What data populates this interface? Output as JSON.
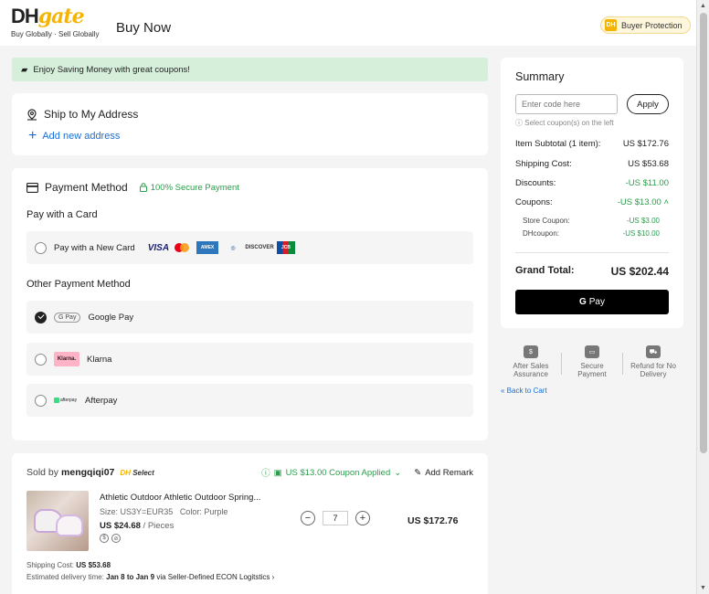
{
  "header": {
    "logo_dh": "DH",
    "logo_gate": "gate",
    "logo_tagline": "Buy Globally · Sell Globally",
    "page_title": "Buy Now",
    "buyer_protection": "Buyer Protection",
    "bp_badge": "DH"
  },
  "banner": {
    "text": "Enjoy Saving Money with great coupons!"
  },
  "address": {
    "title": "Ship to My Address",
    "add_link": "Add new address"
  },
  "payment": {
    "title": "Payment Method",
    "secure": "100% Secure Payment",
    "card_heading": "Pay with a Card",
    "new_card": "Pay with a New Card",
    "card_logos": [
      "VISA",
      "mastercard",
      "AMERICAN EXPRESS",
      "Diners",
      "DISCOVER",
      "JCB"
    ],
    "other_heading": "Other Payment Method",
    "options": [
      {
        "label": "Google Pay",
        "logo": "G Pay",
        "checked": true
      },
      {
        "label": "Klarna",
        "logo": "Klarna.",
        "checked": false
      },
      {
        "label": "Afterpay",
        "logo": "afterpay",
        "checked": false
      }
    ]
  },
  "seller": {
    "sold_by": "Sold by",
    "name": "mengqiqi07",
    "badge_dh": "DH",
    "badge_select": "Select",
    "coupon_applied": "US $13.00 Coupon Applied",
    "add_remark": "Add Remark",
    "product": {
      "title": "Athletic Outdoor Athletic Outdoor Spring...",
      "size": "Size: US3Y=EUR35",
      "color": "Color: Purple",
      "price": "US $24.68",
      "unit": "/ Pieces",
      "quantity": "7",
      "line_total": "US $172.76"
    },
    "shipping_label": "Shipping Cost:",
    "shipping_value": "US $53.68",
    "delivery_label": "Estimated delivery time:",
    "delivery_value": "Jan 8 to Jan 9",
    "delivery_via": "via Seller-Defined ECON Logitstics"
  },
  "summary": {
    "title": "Summary",
    "code_placeholder": "Enter code here",
    "apply": "Apply",
    "coupon_hint": "Select coupon(s) on the left",
    "rows": [
      {
        "label": "Item Subtotal (1 item):",
        "value": "US $172.76"
      },
      {
        "label": "Shipping Cost:",
        "value": "US $53.68"
      },
      {
        "label": "Discounts:",
        "value": "-US $11.00"
      },
      {
        "label": "Coupons:",
        "value": "-US $13.00"
      }
    ],
    "sub_rows": [
      {
        "label": "Store Coupon:",
        "value": "-US $3.00"
      },
      {
        "label": "DHcoupon:",
        "value": "-US $10.00"
      }
    ],
    "grand_label": "Grand Total:",
    "grand_value": "US $202.44",
    "gpay_g": "G",
    "gpay_text": "Pay"
  },
  "assurance": [
    {
      "line1": "After Sales",
      "line2": "Assurance"
    },
    {
      "line1": "Secure",
      "line2": "Payment"
    },
    {
      "line1": "Refund for No",
      "line2": "Delivery"
    }
  ],
  "back_to_cart": "« Back to Cart",
  "colors": {
    "accent_green": "#2a9d4b",
    "link_blue": "#1a6fd6",
    "brand_yellow": "#f6b400",
    "banner_bg": "#d6efda"
  }
}
